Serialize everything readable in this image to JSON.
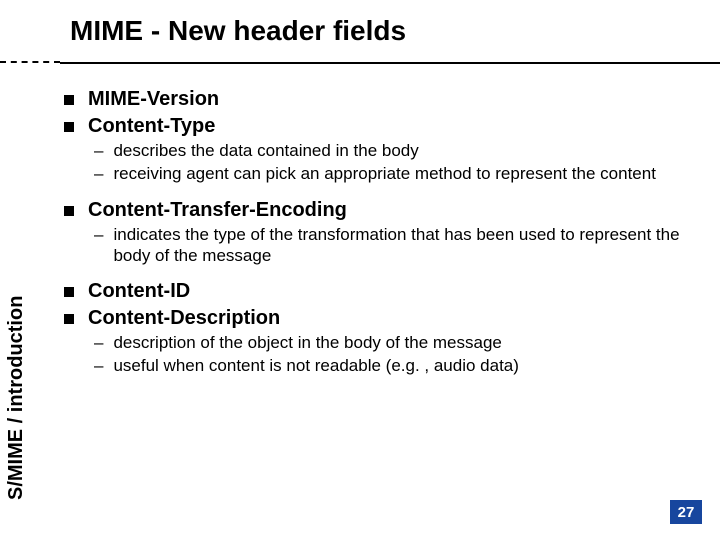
{
  "title": "MIME - New header fields",
  "sidebar": "S/MIME / introduction",
  "page_number": "27",
  "items": {
    "mime_version": "MIME-Version",
    "content_type": "Content-Type",
    "ct_sub1": "describes the data contained in the body",
    "ct_sub2": "receiving agent can pick an appropriate method to represent the content",
    "cte": "Content-Transfer-Encoding",
    "cte_sub1": "indicates the type of the transformation that has been used to represent the body of the message",
    "content_id": "Content-ID",
    "content_desc": "Content-Description",
    "cd_sub1": "description of the object in the body of the message",
    "cd_sub2": "useful when content is not readable (e.g. , audio data)"
  }
}
